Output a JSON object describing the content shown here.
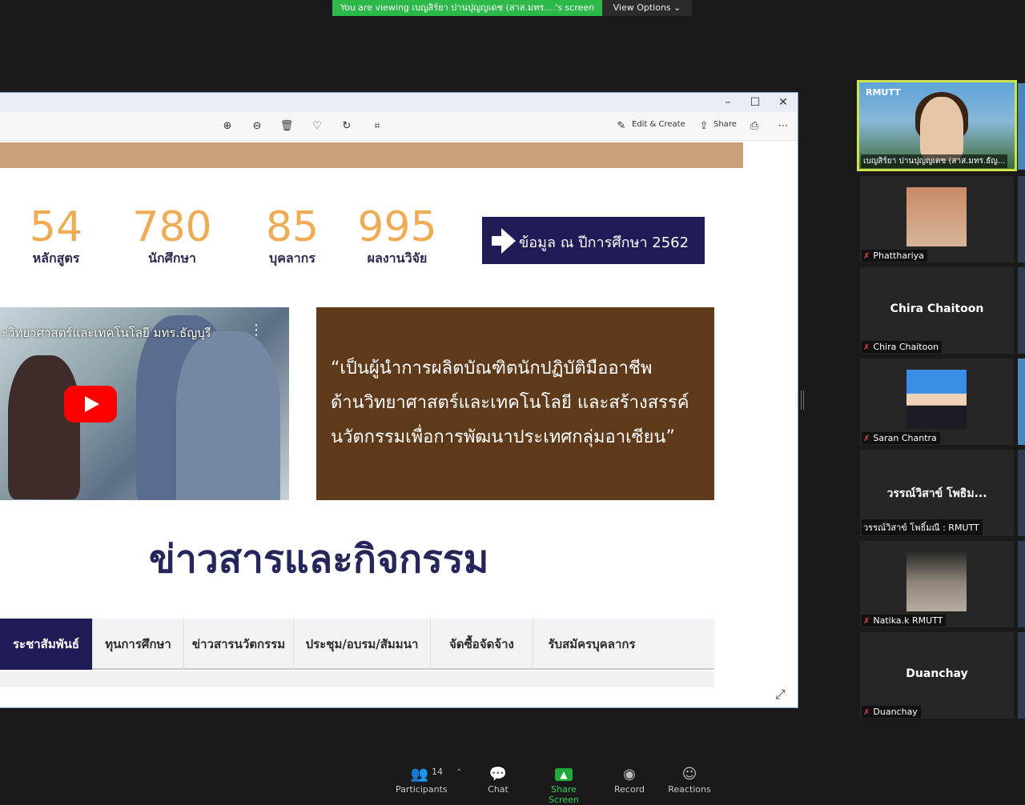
{
  "banner": {
    "text": "You are viewing เบญสิร์ยา ปานปุญญเดช (สาส.มทร....'s screen",
    "view_options": "View Options ⌄"
  },
  "toolbar": {
    "edit_create": "Edit & Create",
    "share": "Share"
  },
  "stats": [
    {
      "value": "54",
      "label": "หลักสูตร"
    },
    {
      "value": "780",
      "label": "นักศึกษา"
    },
    {
      "value": "85",
      "label": "บุคลากร"
    },
    {
      "value": "995",
      "label": "ผลงานวิจัย"
    }
  ],
  "info_button": "ข้อมูล ณ ปีการศึกษา 2562",
  "video": {
    "title": "ะวิทยาศาสตร์และเทคโนโลยี มทร.ธัญบุรี"
  },
  "quote": {
    "line1": "“เป็นผู้นำการผลิตบัณฑิตนักปฏิบัติมืออาชีพ",
    "line2": "ด้านวิทยาศาสตร์และเทคโนโลยี และสร้างสรรค์",
    "line3": "นวัตกรรมเพื่อการพัฒนาประเทศกลุ่มอาเซียน”"
  },
  "news_title": "ข่าวสารและกิจกรรม",
  "tabs": [
    {
      "label": "ระชาสัมพันธ์"
    },
    {
      "label": "ทุนการศึกษา"
    },
    {
      "label": "ข่าวสารนวัตกรรม"
    },
    {
      "label": "ประชุม/อบรม/สัมมนา"
    },
    {
      "label": "จัดซื้อจัดจ้าง"
    },
    {
      "label": "รับสมัครบุคลากร"
    }
  ],
  "participants": {
    "speaker": {
      "name": "เบญสิร์ยา ปานปุญญเดช (สาส.มทร.ธัญ...",
      "logo": "RMUTT"
    },
    "tiles": [
      {
        "name": "Phatthariya",
        "big": ""
      },
      {
        "name": "Chira Chaitoon",
        "big": "Chira Chaitoon"
      },
      {
        "name": "Saran Chantra",
        "big": ""
      },
      {
        "name": "วรรณ์วิสาข์ โพธิ์มณี : RMUTT",
        "big": "วรรณ์วิสาข์ โพธิม..."
      },
      {
        "name": "Natika.k RMUTT",
        "big": ""
      },
      {
        "name": "Duanchay",
        "big": "Duanchay"
      }
    ]
  },
  "controls": {
    "participants_label": "Participants",
    "participants_count": "14",
    "chat": "Chat",
    "share_screen": "Share Screen",
    "record": "Record",
    "reactions": "Reactions"
  }
}
